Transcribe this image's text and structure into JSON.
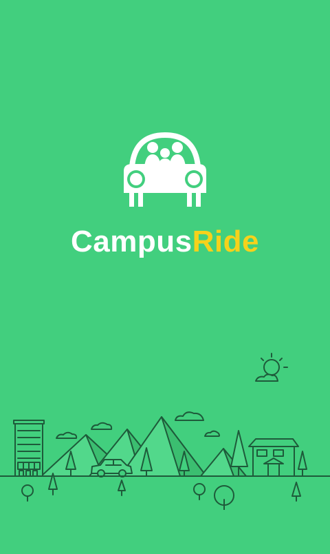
{
  "app": {
    "brand_part1": "Campus",
    "brand_part2": "Ride",
    "brand_colors": {
      "background": "#42CF7E",
      "primary_text": "#ffffff",
      "accent_text": "#F6D21B",
      "line": "#1E5A3A"
    }
  },
  "icons": {
    "logo": "car-with-passengers-icon",
    "sun": "sun-icon",
    "cloud": "cloud-icon",
    "tree": "tree-icon",
    "building": "building-icon",
    "house": "house-icon",
    "car": "car-icon",
    "mountain": "mountain-icon"
  }
}
